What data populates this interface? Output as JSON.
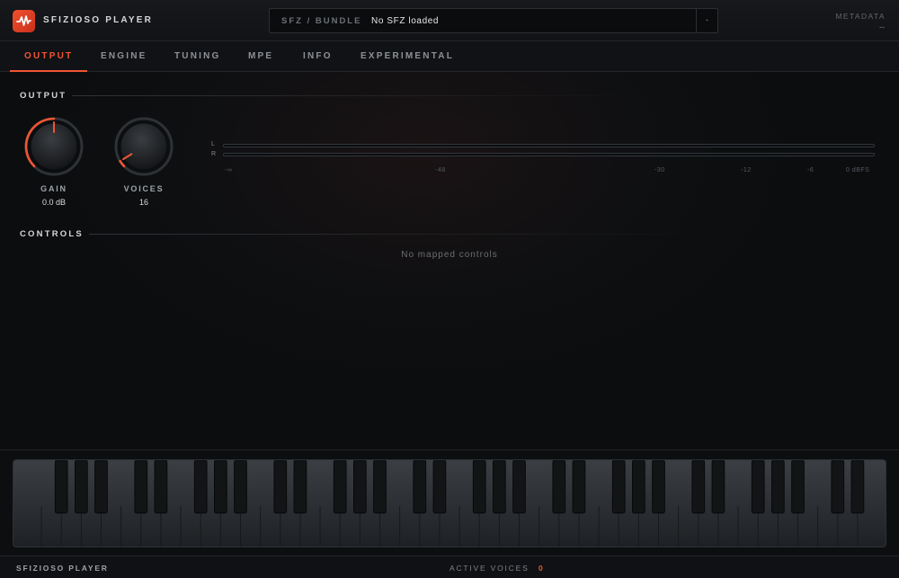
{
  "app": {
    "title": "SFIZIOSO PLAYER"
  },
  "header": {
    "sfz_label": "SFZ / BUNDLE",
    "sfz_value": "No SFZ loaded",
    "sfz_button": "-",
    "metadata_label": "METADATA",
    "metadata_value": "--"
  },
  "tabs": [
    {
      "label": "OUTPUT",
      "active": true
    },
    {
      "label": "ENGINE",
      "active": false
    },
    {
      "label": "TUNING",
      "active": false
    },
    {
      "label": "MPE",
      "active": false
    },
    {
      "label": "INFO",
      "active": false
    },
    {
      "label": "EXPERIMENTAL",
      "active": false
    }
  ],
  "output": {
    "section_title": "OUTPUT",
    "gain": {
      "label": "GAIN",
      "value": "0.0 dB",
      "level": 0.5
    },
    "voices": {
      "label": "VOICES",
      "value": "16",
      "level": 0.05
    },
    "meters": {
      "left_label": "L",
      "right_label": "R",
      "left_level": 0,
      "right_level": 0,
      "scale": [
        "-∞",
        "-48",
        "-30",
        "-12",
        "-6",
        "0 dBFS"
      ]
    }
  },
  "controls": {
    "section_title": "CONTROLS",
    "empty_message": "No mapped controls"
  },
  "footer": {
    "title": "SFIZIOSO PLAYER",
    "active_voices_label": "ACTIVE VOICES",
    "active_voices_count": "0"
  },
  "colors": {
    "accent": "#ef5533",
    "background": "#0c0e10",
    "panel": "#111316"
  },
  "icons": {
    "logo": "waveform-logo-icon"
  }
}
